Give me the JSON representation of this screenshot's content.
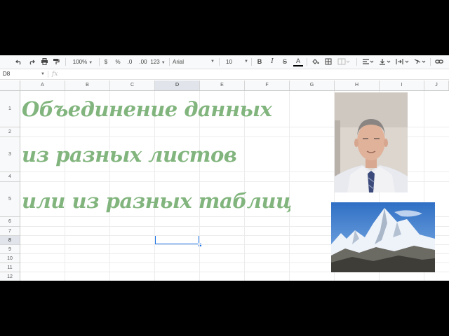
{
  "toolbar": {
    "zoom": "100%",
    "currency": "$",
    "percent": "%",
    "dec_decrease": ".0",
    "dec_increase": ".00",
    "more_formats": "123",
    "font": "Arial",
    "font_size": "10",
    "bold": "B",
    "italic": "I",
    "strike": "S",
    "text_color": "A"
  },
  "namebox": {
    "value": "D8"
  },
  "formula": {
    "fx_label": "fx"
  },
  "columns": [
    "A",
    "B",
    "C",
    "D",
    "E",
    "F",
    "G",
    "H",
    "I",
    "J"
  ],
  "selected_column": "D",
  "rows": [
    "1",
    "2",
    "3",
    "4",
    "5",
    "6",
    "7",
    "8",
    "9",
    "10",
    "11",
    "12"
  ],
  "selected_row": "8",
  "title_lines": [
    "Объединение данных",
    "из разных листов",
    "или из разных таблиц"
  ],
  "colors": {
    "title": "#82b57e",
    "selection": "#1a73e8"
  }
}
